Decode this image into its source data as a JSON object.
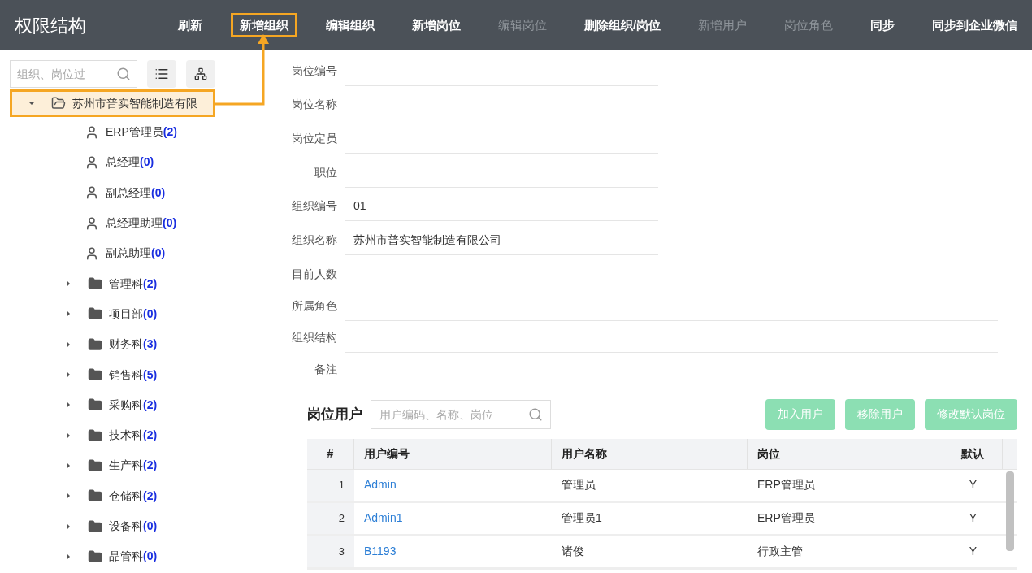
{
  "header": {
    "title": "权限结构",
    "actions": [
      {
        "label": "刷新",
        "disabled": false,
        "highlighted": false
      },
      {
        "label": "新增组织",
        "disabled": false,
        "highlighted": true
      },
      {
        "label": "编辑组织",
        "disabled": false,
        "highlighted": false
      },
      {
        "label": "新增岗位",
        "disabled": false,
        "highlighted": false
      },
      {
        "label": "编辑岗位",
        "disabled": true,
        "highlighted": false
      },
      {
        "label": "删除组织/岗位",
        "disabled": false,
        "highlighted": false
      },
      {
        "label": "新增用户",
        "disabled": true,
        "highlighted": false
      },
      {
        "label": "岗位角色",
        "disabled": true,
        "highlighted": false
      },
      {
        "label": "同步",
        "disabled": false,
        "highlighted": false
      },
      {
        "label": "同步到企业微信",
        "disabled": false,
        "highlighted": false
      }
    ]
  },
  "sidebar": {
    "search": {
      "placeholder": "组织、岗位过"
    },
    "tree": [
      {
        "kind": "org",
        "label": "苏州市普实智能制造有限",
        "expanded": true,
        "highlighted": true,
        "children": [
          {
            "kind": "position",
            "label": "ERP管理员",
            "count": "(2)"
          },
          {
            "kind": "position",
            "label": "总经理",
            "count": "(0)"
          },
          {
            "kind": "position",
            "label": "副总经理",
            "count": "(0)"
          },
          {
            "kind": "position",
            "label": "总经理助理",
            "count": "(0)"
          },
          {
            "kind": "position",
            "label": "副总助理",
            "count": "(0)"
          },
          {
            "kind": "org",
            "label": "管理科",
            "count": "(2)",
            "expanded": false
          },
          {
            "kind": "org",
            "label": "项目部",
            "count": "(0)",
            "expanded": false
          },
          {
            "kind": "org",
            "label": "财务科",
            "count": "(3)",
            "expanded": false
          },
          {
            "kind": "org",
            "label": "销售科",
            "count": "(5)",
            "expanded": false
          },
          {
            "kind": "org",
            "label": "采购科",
            "count": "(2)",
            "expanded": false
          },
          {
            "kind": "org",
            "label": "技术科",
            "count": "(2)",
            "expanded": false
          },
          {
            "kind": "org",
            "label": "生产科",
            "count": "(2)",
            "expanded": false
          },
          {
            "kind": "org",
            "label": "仓储科",
            "count": "(2)",
            "expanded": false
          },
          {
            "kind": "org",
            "label": "设备科",
            "count": "(0)",
            "expanded": false
          },
          {
            "kind": "org",
            "label": "品管科",
            "count": "(0)",
            "expanded": false
          }
        ]
      }
    ]
  },
  "form": {
    "fields": [
      {
        "label": "岗位编号",
        "wide": false
      },
      {
        "label": "岗位名称",
        "wide": false
      },
      {
        "label": "岗位定员",
        "wide": false
      },
      {
        "label": "职位",
        "wide": false
      },
      {
        "label": "组织编号",
        "value": "01",
        "wide": false
      },
      {
        "label": "组织名称",
        "value": "苏州市普实智能制造有限公司",
        "wide": false
      },
      {
        "label": "目前人数",
        "wide": false
      },
      {
        "label": "所属角色",
        "wide": true
      },
      {
        "label": "组织结构",
        "wide": true
      },
      {
        "label": "备注",
        "wide": true
      }
    ]
  },
  "users": {
    "title": "岗位用户",
    "search": {
      "placeholder": "用户编码、名称、岗位"
    },
    "buttons": [
      "加入用户",
      "移除用户",
      "修改默认岗位"
    ],
    "table": {
      "columns": [
        "#",
        "用户编号",
        "用户名称",
        "岗位",
        "默认"
      ],
      "rows": [
        [
          "1",
          "Admin",
          "管理员",
          "ERP管理员",
          "Y"
        ],
        [
          "2",
          "Admin1",
          "管理员1",
          "ERP管理员",
          "Y"
        ],
        [
          "3",
          "B1193",
          "诸俊",
          "行政主管",
          "Y"
        ]
      ]
    }
  }
}
